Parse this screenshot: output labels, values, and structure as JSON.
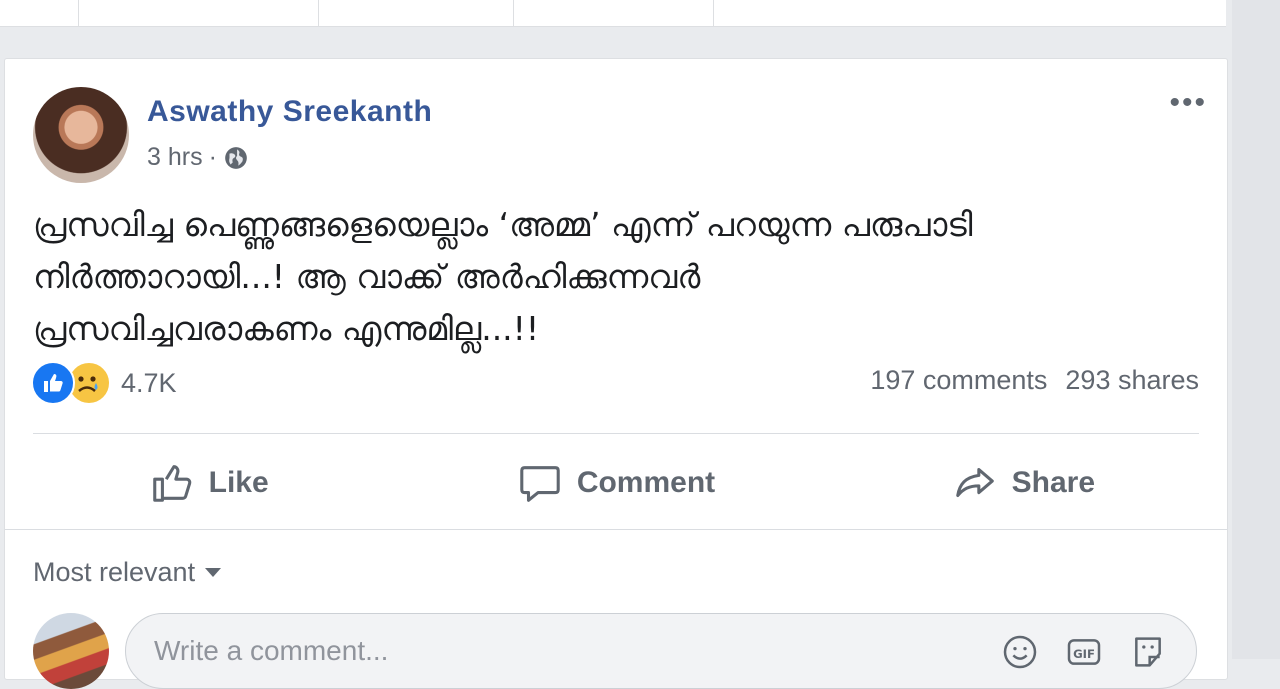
{
  "post": {
    "author": "Aswathy Sreekanth",
    "time": "3 hrs",
    "separator": "·",
    "text_lines": [
      "പ്രസവിച്ച പെണ്ണുങ്ങളെയെല്ലാം ‘അമ്മ’ എന്ന് പറയുന്ന പരുപാടി",
      "നിർത്താറായി...! ആ വാക്ക് അർഹിക്കുന്നവർ",
      "പ്രസവിച്ചവരാകണം എന്നുമില്ല...!!"
    ],
    "reaction_count": "4.7K",
    "comments_count": "197 comments",
    "shares_count": "293 shares",
    "more_label": "•••"
  },
  "actions": {
    "like": "Like",
    "comment": "Comment",
    "share": "Share"
  },
  "comments": {
    "sort_label": "Most relevant",
    "input_placeholder": "Write a comment..."
  },
  "colors": {
    "author_blue": "#385898",
    "like_blue": "#1877f2",
    "sad_yellow": "#f7c543",
    "muted_text": "#616770"
  },
  "icons": [
    "globe-icon",
    "more-icon",
    "like-reaction-icon",
    "sad-reaction-icon",
    "thumbs-up-icon",
    "comment-bubble-icon",
    "share-arrow-icon",
    "caret-down-icon",
    "emoji-icon",
    "gif-icon",
    "sticker-icon"
  ]
}
